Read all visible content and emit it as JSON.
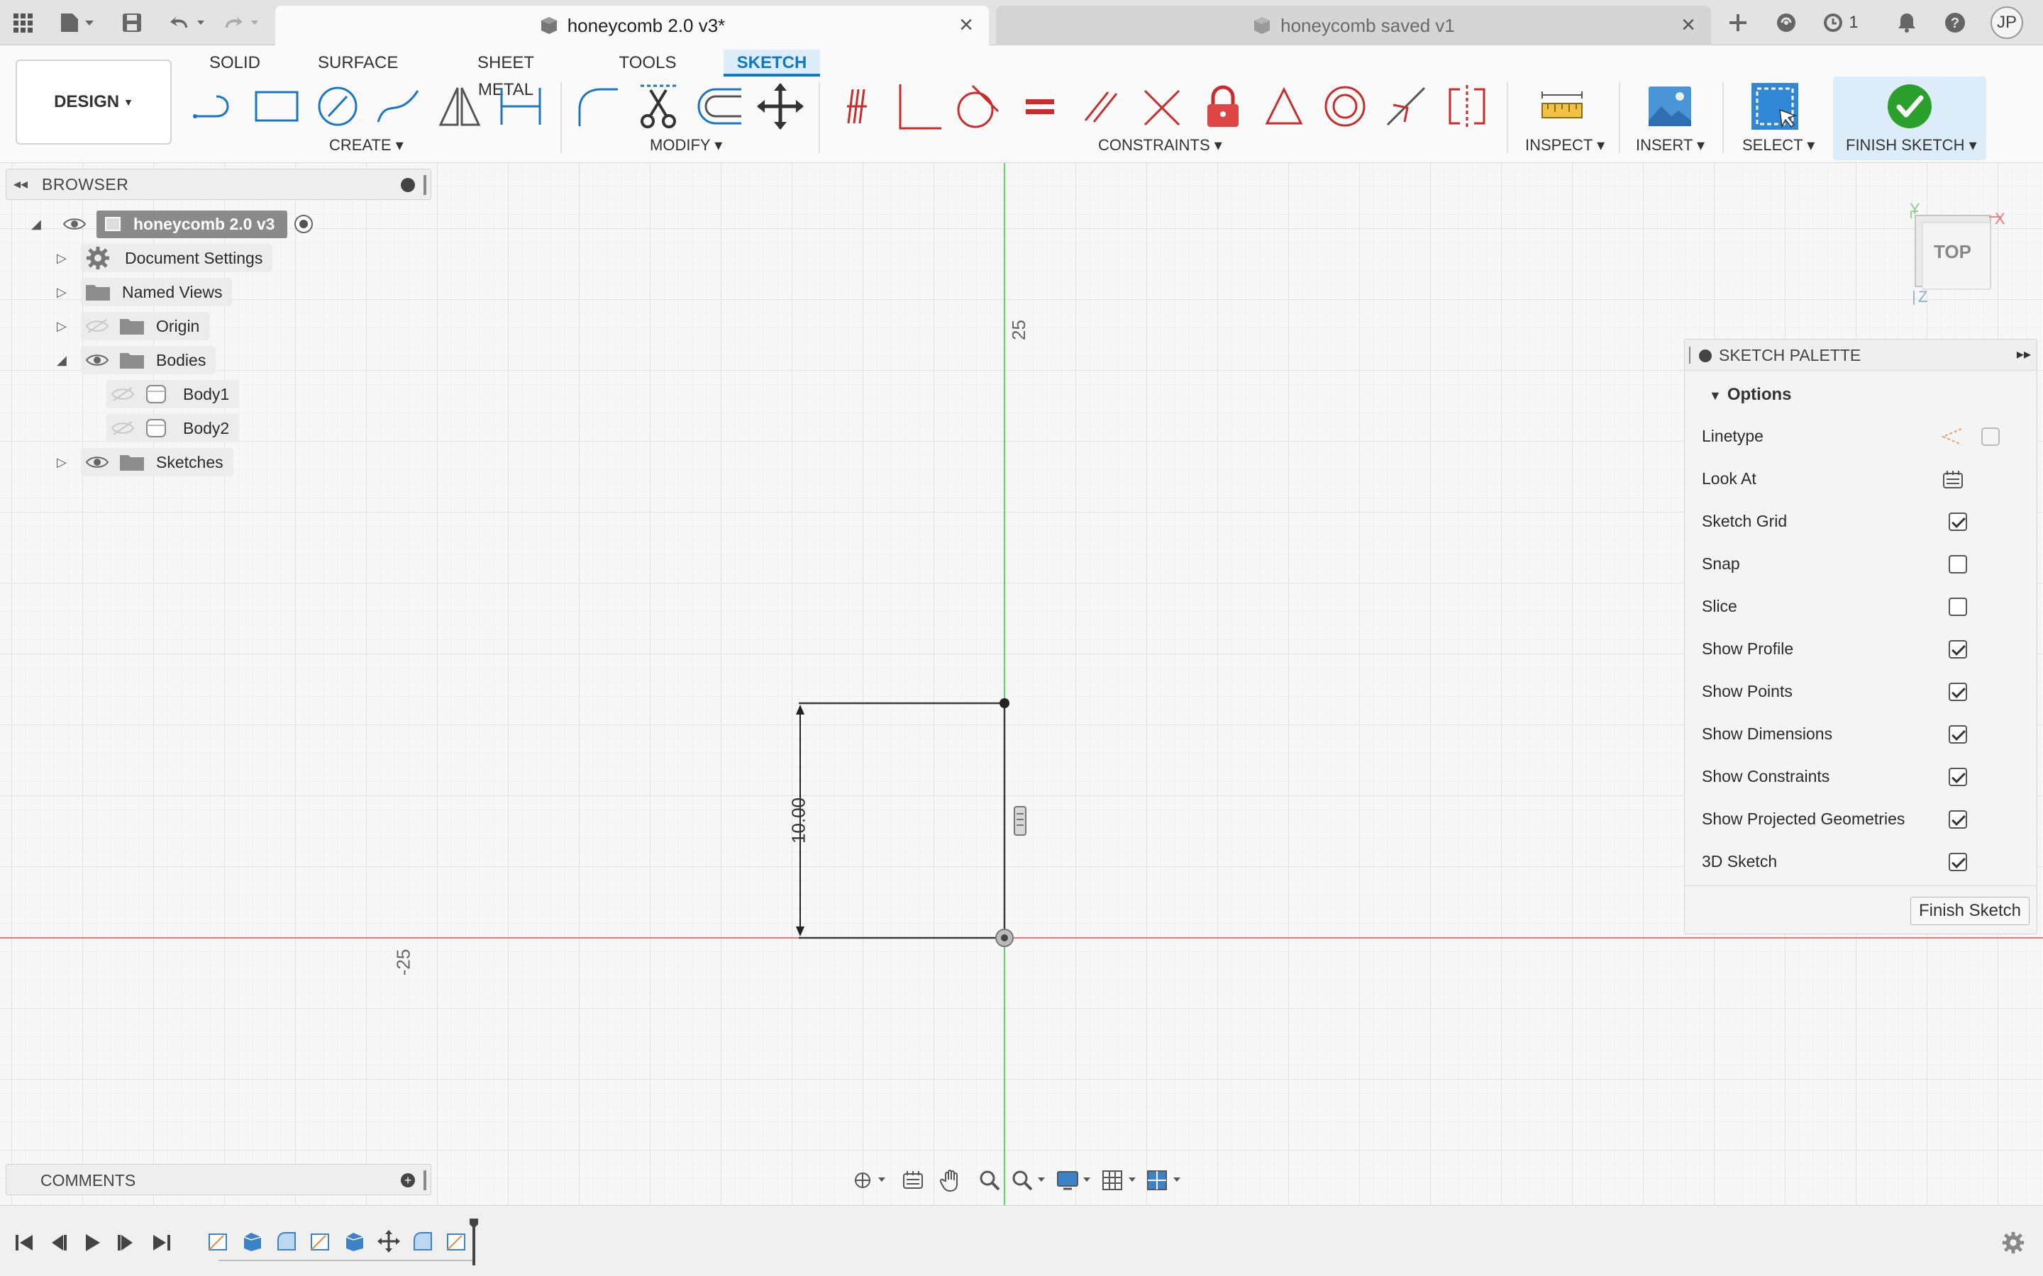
{
  "titlebar": {
    "active_tab": "honeycomb 2.0 v3*",
    "inactive_tab": "honeycomb saved v1",
    "job_count": "1",
    "user_initials": "JP"
  },
  "toolbar": {
    "workspace": "DESIGN",
    "tabs": [
      "SOLID",
      "SURFACE",
      "SHEET METAL",
      "TOOLS",
      "SKETCH"
    ],
    "active_tab": "SKETCH",
    "groups": {
      "create": "CREATE",
      "modify": "MODIFY",
      "constraints": "CONSTRAINTS",
      "inspect": "INSPECT",
      "insert": "INSERT",
      "select": "SELECT",
      "finish": "FINISH SKETCH"
    }
  },
  "browser": {
    "title": "BROWSER",
    "items": [
      {
        "label": "honeycomb 2.0 v3"
      },
      {
        "label": "Document Settings"
      },
      {
        "label": "Named Views"
      },
      {
        "label": "Origin"
      },
      {
        "label": "Bodies"
      },
      {
        "label": "Body1"
      },
      {
        "label": "Body2"
      },
      {
        "label": "Sketches"
      }
    ]
  },
  "canvas": {
    "dimension_label": "10.00",
    "axis_label_top": "25",
    "axis_label_left": "-25"
  },
  "viewcube": {
    "face": "TOP",
    "axis_x": "X",
    "axis_y": "Y",
    "axis_z": "Z"
  },
  "palette": {
    "title": "SKETCH PALETTE",
    "section": "Options",
    "rows": [
      {
        "label": "Linetype",
        "type": "icons"
      },
      {
        "label": "Look At",
        "type": "icon"
      },
      {
        "label": "Sketch Grid",
        "type": "checkbox",
        "checked": true
      },
      {
        "label": "Snap",
        "type": "checkbox",
        "checked": false
      },
      {
        "label": "Slice",
        "type": "checkbox",
        "checked": false
      },
      {
        "label": "Show Profile",
        "type": "checkbox",
        "checked": true
      },
      {
        "label": "Show Points",
        "type": "checkbox",
        "checked": true
      },
      {
        "label": "Show Dimensions",
        "type": "checkbox",
        "checked": true
      },
      {
        "label": "Show Constraints",
        "type": "checkbox",
        "checked": true
      },
      {
        "label": "Show Projected Geometries",
        "type": "checkbox",
        "checked": true
      },
      {
        "label": "3D Sketch",
        "type": "checkbox",
        "checked": true
      }
    ],
    "finish_button": "Finish Sketch"
  },
  "comments": {
    "title": "COMMENTS"
  },
  "colors": {
    "accent": "#0e7ac3",
    "constraint_red": "#cc2b2b",
    "axis_green": "#5fd35f",
    "axis_red": "#e87a7a",
    "finish_green": "#2ca02c"
  }
}
